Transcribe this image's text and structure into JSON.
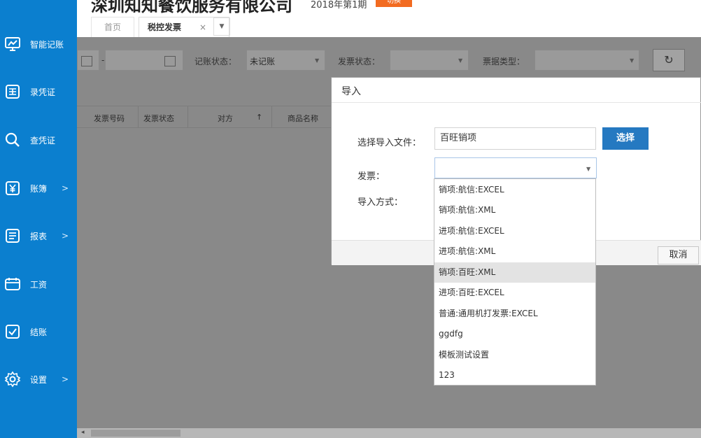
{
  "header": {
    "company_name": "深圳知知餐饮服务有限公司",
    "period": "2018年第1期",
    "switch_label": "切换"
  },
  "sidebar": {
    "items": [
      {
        "label": "智能记账",
        "icon": "monitor-icon",
        "arrow": ""
      },
      {
        "label": "录凭证",
        "icon": "voucher-entry-icon",
        "arrow": ""
      },
      {
        "label": "查凭证",
        "icon": "search-icon",
        "arrow": ""
      },
      {
        "label": "账簿",
        "icon": "yen-icon",
        "arrow": ">"
      },
      {
        "label": "报表",
        "icon": "report-icon",
        "arrow": ">"
      },
      {
        "label": "工资",
        "icon": "payroll-icon",
        "arrow": ""
      },
      {
        "label": "结账",
        "icon": "checkout-icon",
        "arrow": ""
      },
      {
        "label": "设置",
        "icon": "gear-icon",
        "arrow": ">"
      }
    ]
  },
  "tabs": {
    "home": "首页",
    "tax_invoice": "税控发票",
    "close": "×"
  },
  "filters": {
    "date_separator": "-",
    "posting_status_label": "记账状态：",
    "posting_status_value": "未记账",
    "invoice_status_label": "发票状态：",
    "invoice_status_value": "",
    "bill_type_label": "票据类型：",
    "bill_type_value": "",
    "refresh_icon": "refresh-icon"
  },
  "table": {
    "columns": [
      "发票号码",
      "发票状态",
      "对方",
      "商品名称"
    ],
    "sort_indicator": "↑"
  },
  "dialog": {
    "title": "导入",
    "file_label": "选择导入文件：",
    "file_value": "百旺销项",
    "choose_button": "选择",
    "invoice_label": "发票：",
    "invoice_value": "",
    "import_mode_label": "导入方式：",
    "cancel_button": "取消"
  },
  "dropdown": {
    "options": [
      "销项:航信:EXCEL",
      "销项:航信:XML",
      "进项:航信:EXCEL",
      "进项:航信:XML",
      "销项:百旺:XML",
      "进项:百旺:EXCEL",
      "普通:通用机打发票:EXCEL",
      "ggdfg",
      "模板测试设置",
      "123"
    ],
    "highlighted": "销项:百旺:XML"
  },
  "colors": {
    "sidebar": "#0b7fcf",
    "overlay": "#898989",
    "switch": "#f26b21",
    "primary_button": "#2579c1"
  }
}
